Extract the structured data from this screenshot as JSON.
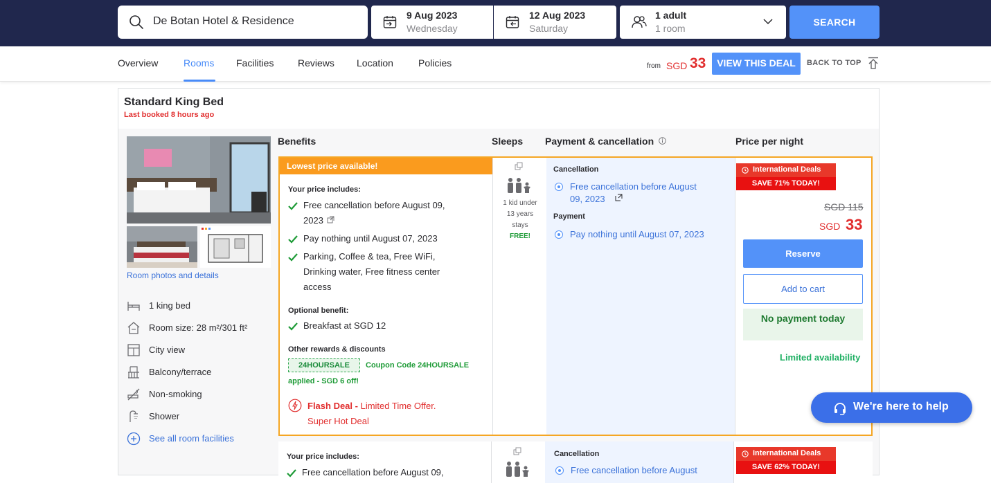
{
  "search": {
    "hotel": "De Botan Hotel & Residence",
    "checkin_date": "9 Aug 2023",
    "checkin_day": "Wednesday",
    "checkout_date": "12 Aug 2023",
    "checkout_day": "Saturday",
    "guests": "1 adult",
    "rooms": "1 room",
    "button": "SEARCH"
  },
  "nav": {
    "tabs": [
      "Overview",
      "Rooms",
      "Facilities",
      "Reviews",
      "Location",
      "Policies"
    ],
    "from_label": "from",
    "currency": "SGD",
    "from_price": "33",
    "deal_button": "VIEW THIS DEAL",
    "back_to_top": "BACK TO TOP"
  },
  "room": {
    "title": "Standard King Bed",
    "last_booked": "Last booked 8 hours ago",
    "photos_link": "Room photos and details",
    "amenities": [
      "1 king bed",
      "Room size: 28 m²/301 ft²",
      "City view",
      "Balcony/terrace",
      "Non-smoking",
      "Shower"
    ],
    "see_all": "See all room facilities"
  },
  "columns": {
    "benefits": "Benefits",
    "sleeps": "Sleeps",
    "payment": "Payment & cancellation",
    "price": "Price per night"
  },
  "offer1": {
    "badge": "Lowest price available!",
    "includes_label": "Your price includes:",
    "benefit1_line1": "Free cancellation before August 09,",
    "benefit1_line2": "2023",
    "benefit2": "Pay nothing until August 07, 2023",
    "benefit3_line1": "Parking, Coffee & tea, Free WiFi,",
    "benefit3_line2": "Drinking water, Free fitness center",
    "benefit3_line3": "access",
    "optional_label": "Optional benefit:",
    "optional1": "Breakfast at SGD 12",
    "rewards_label": "Other rewards & discounts",
    "coupon": "24HOURSALE",
    "coupon_text1": "Coupon Code 24HOURSALE",
    "coupon_text2": "applied - SGD 6 off!",
    "flash_bold": "Flash Deal -",
    "flash_text1": "Limited Time Offer.",
    "flash_text2": "Super Hot Deal",
    "sleeps_line1": "1 kid under",
    "sleeps_line2": "13 years",
    "sleeps_line3": "stays",
    "sleeps_free": "FREE!",
    "cancel_label": "Cancellation",
    "cancel_line1": "Free cancellation before August",
    "cancel_line2": "09, 2023",
    "payment_label": "Payment",
    "payment_item": "Pay nothing until August 07, 2023",
    "intl_badge": "International Deals",
    "save_badge": "SAVE 71% TODAY!",
    "old_price": "SGD 115",
    "currency": "SGD",
    "price": "33",
    "reserve": "Reserve",
    "add_to_cart": "Add to cart",
    "no_payment": "No payment today",
    "limited": "Limited availability"
  },
  "offer2": {
    "includes_label": "Your price includes:",
    "benefit1": "Free cancellation before August 09,",
    "cancel_label": "Cancellation",
    "cancel_line1": "Free cancellation before August",
    "intl_badge": "International Deals",
    "save_badge": "SAVE 62% TODAY!"
  },
  "help": {
    "label": "We're here to help"
  },
  "colors": {
    "header_bg": "#20274d",
    "accent_blue": "#5392f9",
    "price_red": "#e12d2d",
    "orange": "#fa9b1e",
    "green": "#1e9b37"
  }
}
